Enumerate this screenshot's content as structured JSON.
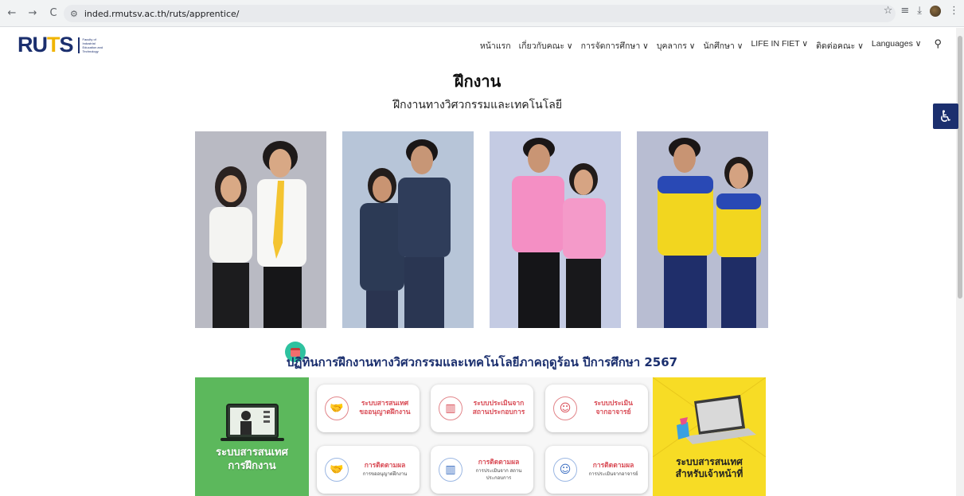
{
  "browser": {
    "back": "←",
    "forward": "→",
    "reload": "C",
    "url": "inded.rmutsv.ac.th/ruts/apprentice/"
  },
  "logo": {
    "mark_a": "RU",
    "mark_b": "T",
    "mark_c": "S",
    "subtitle": "Faculty of Industrial Education and Technology"
  },
  "menu": {
    "items": [
      "หน้าแรก",
      "เกี่ยวกับคณะ ∨",
      "การจัดการศึกษา ∨",
      "บุคลากร ∨",
      "นักศึกษา ∨",
      "LIFE IN FIET ∨",
      "ติดต่อคณะ ∨",
      "Languages ∨"
    ]
  },
  "page": {
    "title": "ฝึกงาน",
    "subtitle": "ฝึกงานทางวิศวกรรมและเทคโนโลยี"
  },
  "section": {
    "title": "ปฏิทินการฝึกงานทางวิศวกรรมและเทคโนโลยีภาคฤดูร้อน ปีการศึกษา 2567"
  },
  "systems": {
    "left_label_1": "ระบบสารสนเทศ",
    "left_label_2": "การฝึกงาน",
    "right_label_1": "ระบบสารสนเทศ",
    "right_label_2": "สำหรับเจ้าหน้าที่"
  },
  "cards": [
    {
      "t1": "ระบบสารสนเทศ",
      "t2": "ขออนุญาตฝึกงาน",
      "t3": ""
    },
    {
      "t1": "ระบบประเมินจาก",
      "t2": "สถานประกอบการ",
      "t3": ""
    },
    {
      "t1": "ระบบประเมิน",
      "t2": "จากอาจารย์",
      "t3": ""
    },
    {
      "t1": "การติดตามผล",
      "t2": "",
      "t3": "การขออนุญาตฝึกงาน"
    },
    {
      "t1": "การติดตามผล",
      "t2": "",
      "t3": "การประเมินจาก สถานประกอบการ"
    },
    {
      "t1": "การติดตามผล",
      "t2": "",
      "t3": "การประเมินจากอาจารย์"
    }
  ]
}
